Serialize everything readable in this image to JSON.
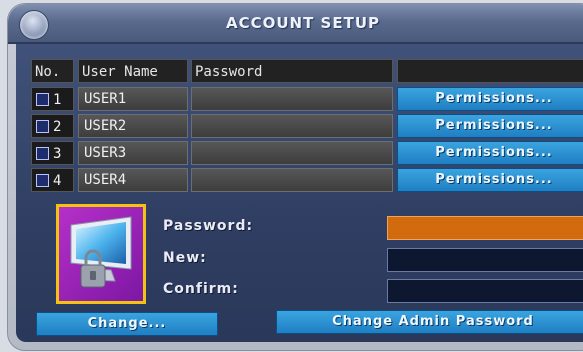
{
  "window": {
    "title": "ACCOUNT SETUP"
  },
  "table": {
    "headers": {
      "no": "No.",
      "user": "User Name",
      "password": "Password",
      "actions": ""
    },
    "rows": [
      {
        "num": "1",
        "user": "USER1",
        "password": "",
        "permissions": "Permissions..."
      },
      {
        "num": "2",
        "user": "USER2",
        "password": "",
        "permissions": "Permissions..."
      },
      {
        "num": "3",
        "user": "USER3",
        "password": "",
        "permissions": "Permissions..."
      },
      {
        "num": "4",
        "user": "USER4",
        "password": "",
        "permissions": "Permissions..."
      }
    ]
  },
  "form": {
    "password_label": "Password:",
    "new_label": "New:",
    "confirm_label": "Confirm:",
    "password_value": "",
    "new_value": "",
    "confirm_value": ""
  },
  "buttons": {
    "change": "Change...",
    "change_admin": "Change Admin Password"
  },
  "icon": "locked-computer-icon",
  "colors": {
    "accent_blue": "#2a8fd0",
    "active_field": "#d26a0e",
    "icon_frame": "#f2c311"
  }
}
